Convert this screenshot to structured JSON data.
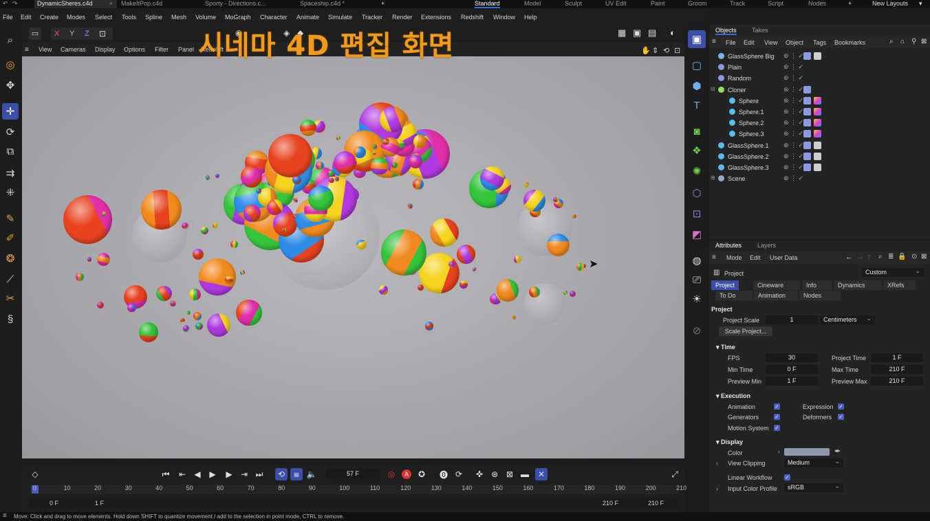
{
  "file_tabs": [
    {
      "label": "DynamicSheres.c4d",
      "active": true
    },
    {
      "label": "MakeItPop.c4d",
      "active": false
    },
    {
      "label": "Sporty - Directions.c...",
      "active": false
    },
    {
      "label": "Spaceship.c4d *",
      "active": false
    }
  ],
  "layout_tabs": [
    "Standard",
    "Model",
    "Sculpt",
    "UV Edit",
    "Paint",
    "Groom",
    "Track",
    "Script",
    "Nodes"
  ],
  "active_layout": "Standard",
  "new_layouts_label": "New Layouts",
  "menu_items": [
    "File",
    "Edit",
    "Create",
    "Modes",
    "Select",
    "Tools",
    "Spline",
    "Mesh",
    "Volume",
    "MoGraph",
    "Character",
    "Animate",
    "Simulate",
    "Tracker",
    "Render",
    "Extensions",
    "Redshift",
    "Window",
    "Help"
  ],
  "axis_lock": [
    "X",
    "Y",
    "Z"
  ],
  "overlay_title": "시네마 4D 편집 화면",
  "viewport_menu": [
    "View",
    "Cameras",
    "Display",
    "Options",
    "Filter",
    "Panel",
    "Redshift"
  ],
  "timeline": {
    "current_frame": "57 F",
    "ticks": [
      "0",
      "10",
      "20",
      "30",
      "40",
      "50",
      "60",
      "70",
      "80",
      "90",
      "100",
      "110",
      "120",
      "130",
      "140",
      "150",
      "160",
      "170",
      "180",
      "190",
      "200",
      "210"
    ],
    "range_start": "0 F",
    "range_preview_start": "1 F",
    "range_end": "210 F",
    "range_end2": "210 F"
  },
  "object_panel": {
    "tabs": [
      "Objects",
      "Takes"
    ],
    "menu": [
      "File",
      "Edit",
      "View",
      "Object",
      "Tags",
      "Bookmarks"
    ],
    "objects": [
      {
        "name": "GlassSphere Big",
        "icon_color": "#7fb0e8"
      },
      {
        "name": "Plain",
        "icon_color": "#8a9ae0"
      },
      {
        "name": "Random",
        "icon_color": "#8a9ae0"
      },
      {
        "name": "Cloner",
        "icon_color": "#8ee05a"
      },
      {
        "name": "Sphere",
        "icon_color": "#5fb8f0"
      },
      {
        "name": "Sphere.1",
        "icon_color": "#5fb8f0"
      },
      {
        "name": "Sphere.2",
        "icon_color": "#5fb8f0"
      },
      {
        "name": "Sphere.3",
        "icon_color": "#5fb8f0"
      },
      {
        "name": "GlassSphere.1",
        "icon_color": "#5fb8f0"
      },
      {
        "name": "GlassSphere.2",
        "icon_color": "#5fb8f0"
      },
      {
        "name": "GlassSphere.3",
        "icon_color": "#5fb8f0"
      },
      {
        "name": "Scene",
        "icon_color": "#9aa6c8"
      }
    ]
  },
  "attributes": {
    "tabs": [
      "Attributes",
      "Layers"
    ],
    "menu": [
      "Mode",
      "Edit",
      "User Data"
    ],
    "object_label": "Project",
    "preset": "Custom",
    "subtabs_row1": [
      "Project",
      "Cineware",
      "Info",
      "Dynamics",
      "XRefs"
    ],
    "subtabs_row2": [
      "To Do",
      "Animation",
      "Nodes"
    ],
    "section_project": "Project",
    "project_scale_label": "Project Scale",
    "project_scale_value": "1",
    "project_scale_unit": "Centimeters",
    "scale_button": "Scale Project...",
    "section_time": "Time",
    "fps_label": "FPS",
    "fps_value": "30",
    "project_time_label": "Project Time",
    "project_time_value": "1 F",
    "min_time_label": "Min Time",
    "min_time_value": "0 F",
    "max_time_label": "Max Time",
    "max_time_value": "210 F",
    "preview_min_label": "Preview Min",
    "preview_min_value": "1 F",
    "preview_max_label": "Preview Max",
    "preview_max_value": "210 F",
    "section_execution": "Execution",
    "animation_label": "Animation",
    "expression_label": "Expression",
    "generators_label": "Generators",
    "deformers_label": "Deformers",
    "motion_system_label": "Motion System",
    "section_display": "Display",
    "color_label": "Color",
    "color_value": "#8e98ad",
    "view_clipping_label": "View Clipping",
    "view_clipping_value": "Medium",
    "linear_workflow_label": "Linear Workflow",
    "input_color_profile_label": "Input Color Profile",
    "input_color_profile_value": "sRGB"
  },
  "status_text": "Move: Click and drag to move elements. Hold down SHIFT to quantize movement / add to the selection in point mode, CTRL to remove."
}
